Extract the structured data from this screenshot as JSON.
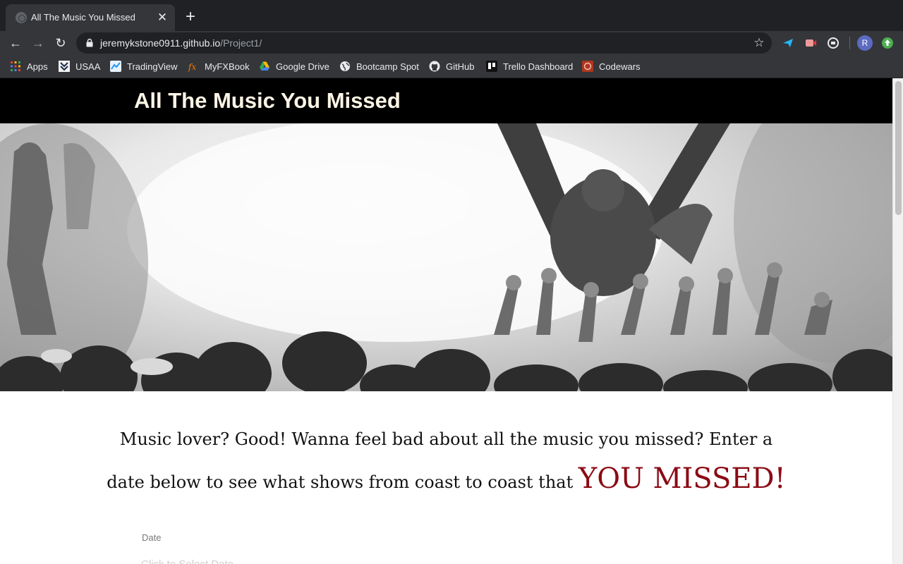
{
  "browser": {
    "tab_title": "All The Music You Missed",
    "tab_close": "✕",
    "new_tab": "+",
    "url_host": "jeremykstone0911.github.io",
    "url_path": "/Project1/",
    "avatar_initial": "R"
  },
  "bookmarks": [
    {
      "label": "Apps",
      "icon": "apps-grid-icon"
    },
    {
      "label": "USAA",
      "icon": "usaa-icon"
    },
    {
      "label": "TradingView",
      "icon": "tradingview-icon"
    },
    {
      "label": "MyFXBook",
      "icon": "myfxbook-icon"
    },
    {
      "label": "Google Drive",
      "icon": "google-drive-icon"
    },
    {
      "label": "Bootcamp Spot",
      "icon": "globe-icon"
    },
    {
      "label": "GitHub",
      "icon": "github-icon"
    },
    {
      "label": "Trello Dashboard",
      "icon": "trello-icon"
    },
    {
      "label": "Codewars",
      "icon": "codewars-icon"
    }
  ],
  "site": {
    "title": "All The Music You Missed",
    "intro_text": "Music lover? Good! Wanna feel bad about all the music you missed? Enter a date below to see what shows from coast to coast that",
    "intro_emphasis": "YOU MISSED!",
    "date_label": "Date",
    "date_placeholder": "Click to Select Date"
  },
  "colors": {
    "header_bg": "#000000",
    "title_color": "#fdf5e6",
    "emphasis_red": "#8b0a14"
  }
}
